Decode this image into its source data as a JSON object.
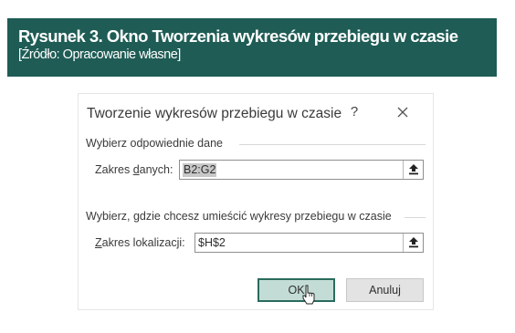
{
  "caption": {
    "title": "Rysunek 3. Okno Tworzenia wykresów przebiegu w czasie",
    "source": "[Źródło: Opracowanie własne]",
    "background_color": "#1e5c55"
  },
  "dialog": {
    "title": "Tworzenie wykresów przebiegu w czasie",
    "help_label": "?",
    "close_icon": "close-icon",
    "data_section": {
      "label": "Wybierz odpowiednie dane",
      "field": {
        "label_before": "Zakres ",
        "label_accel": "d",
        "label_after": "anych:",
        "value": "B2:G2",
        "button_icon": "collapse-dialog-icon"
      }
    },
    "location_section": {
      "label": "Wybierz, gdzie chcesz umieścić wykresy przebiegu w czasie",
      "field": {
        "label_accel": "Z",
        "label_after": "akres lokalizacji:",
        "value": "$H$2",
        "button_icon": "collapse-dialog-icon"
      }
    },
    "buttons": {
      "ok_label": "OK",
      "cancel_label": "Anuluj"
    },
    "pointer_icon": "mouse-pointer-icon"
  }
}
